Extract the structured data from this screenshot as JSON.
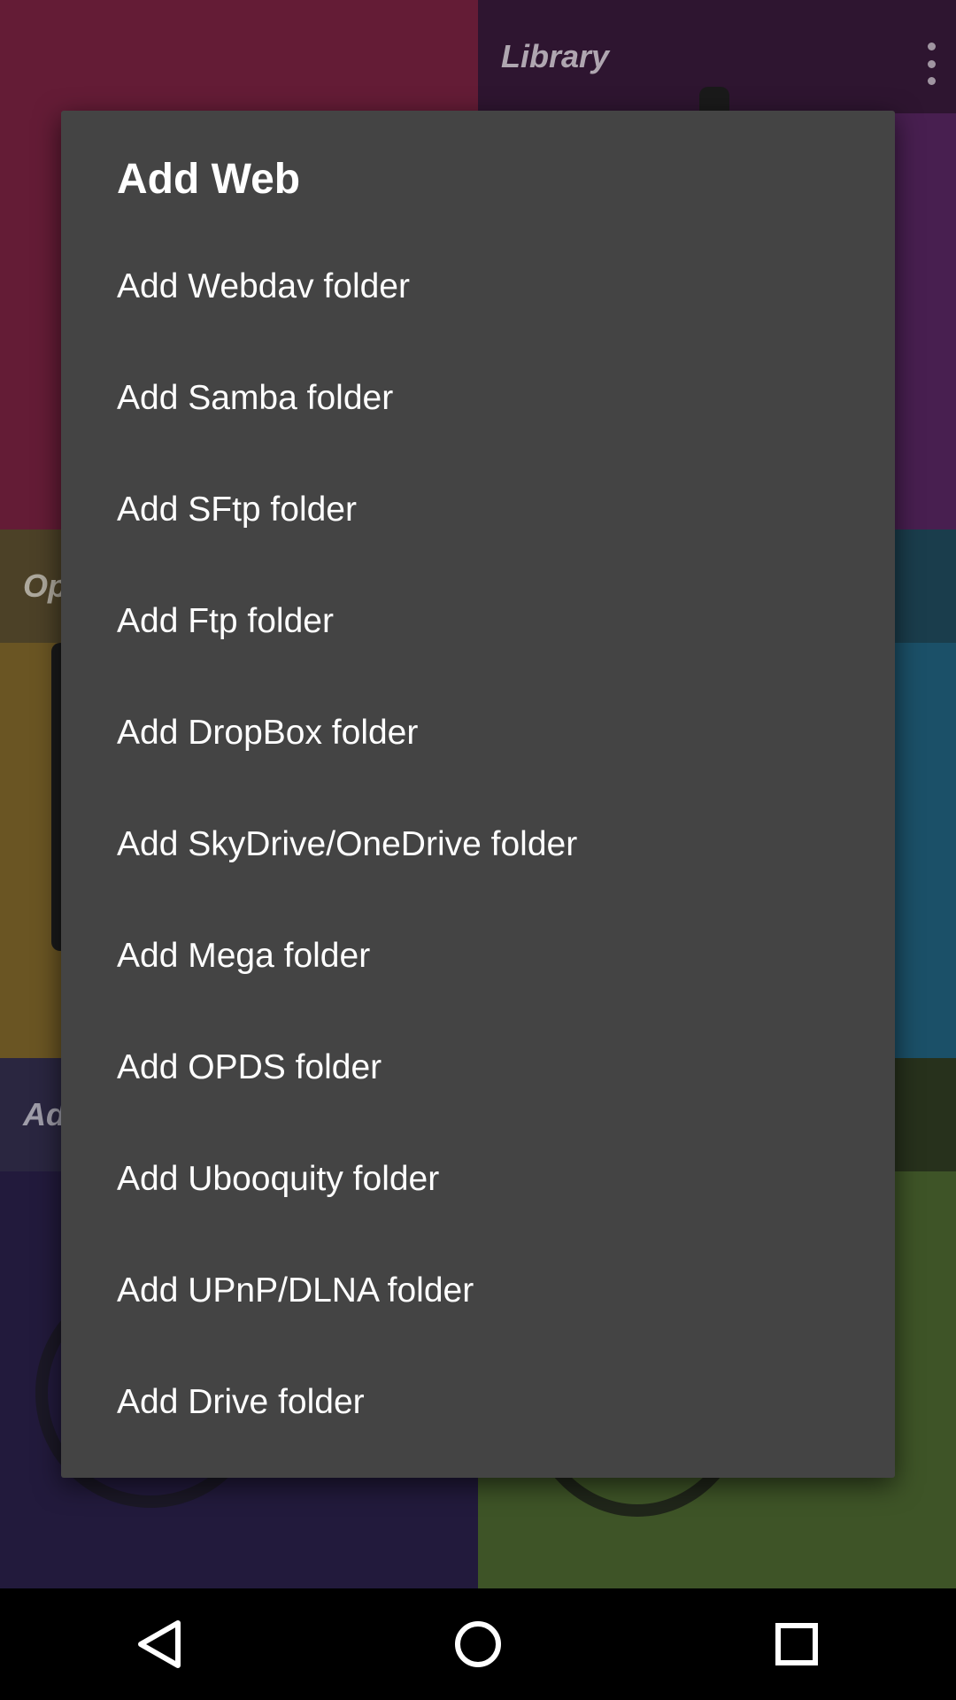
{
  "background": {
    "library_label": "Library",
    "left_mid_label": "Op",
    "left_low_label": "Ad"
  },
  "dialog": {
    "title": "Add Web",
    "items": [
      {
        "label": "Add Webdav folder"
      },
      {
        "label": "Add Samba folder"
      },
      {
        "label": "Add SFtp folder"
      },
      {
        "label": "Add Ftp folder"
      },
      {
        "label": "Add DropBox folder"
      },
      {
        "label": "Add SkyDrive/OneDrive folder"
      },
      {
        "label": "Add Mega folder"
      },
      {
        "label": "Add OPDS folder"
      },
      {
        "label": "Add Ubooquity folder"
      },
      {
        "label": "Add UPnP/DLNA folder"
      },
      {
        "label": "Add Drive folder"
      }
    ]
  },
  "navbar": {
    "icons": [
      "back-icon",
      "home-icon",
      "recents-icon"
    ]
  },
  "colors": {
    "dialog_bg": "#444444",
    "dialog_text": "#ffffff"
  }
}
